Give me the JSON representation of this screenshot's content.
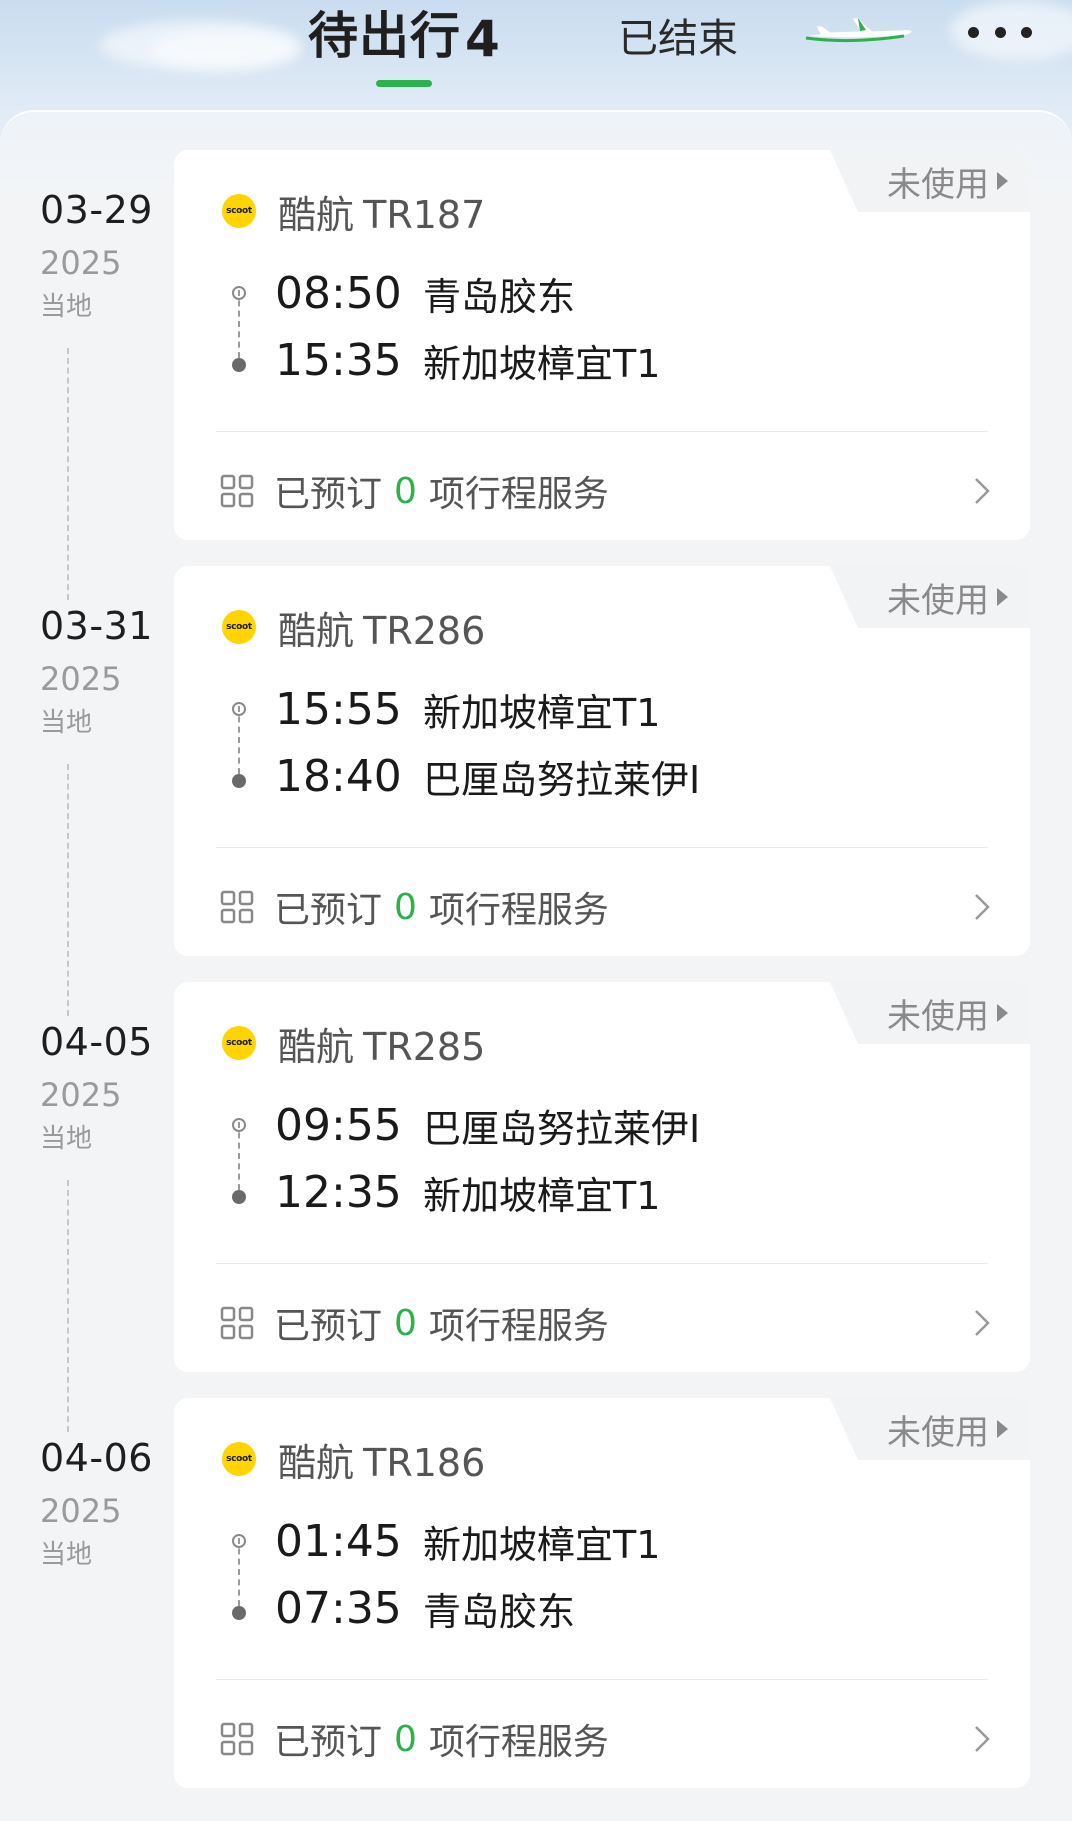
{
  "header": {
    "tab_active_label": "待出行",
    "tab_active_count": "4",
    "tab_inactive_label": "已结束"
  },
  "colors": {
    "accent_green": "#2bb24c",
    "scoot_yellow": "#ffd400"
  },
  "trips": [
    {
      "date_md": "03-29",
      "year": "2025",
      "tz": "当地",
      "status": "未使用",
      "airline": "酷航",
      "flight_no": "TR187",
      "airline_logo_text": "scoot",
      "dep_time": "08:50",
      "dep_airport": "青岛胶东",
      "arr_time": "15:35",
      "arr_airport": "新加坡樟宜T1",
      "services_prefix": "已预订",
      "services_count": "0",
      "services_suffix": "项行程服务"
    },
    {
      "date_md": "03-31",
      "year": "2025",
      "tz": "当地",
      "status": "未使用",
      "airline": "酷航",
      "flight_no": "TR286",
      "airline_logo_text": "scoot",
      "dep_time": "15:55",
      "dep_airport": "新加坡樟宜T1",
      "arr_time": "18:40",
      "arr_airport": "巴厘岛努拉莱伊I",
      "services_prefix": "已预订",
      "services_count": "0",
      "services_suffix": "项行程服务"
    },
    {
      "date_md": "04-05",
      "year": "2025",
      "tz": "当地",
      "status": "未使用",
      "airline": "酷航",
      "flight_no": "TR285",
      "airline_logo_text": "scoot",
      "dep_time": "09:55",
      "dep_airport": "巴厘岛努拉莱伊I",
      "arr_time": "12:35",
      "arr_airport": "新加坡樟宜T1",
      "services_prefix": "已预订",
      "services_count": "0",
      "services_suffix": "项行程服务"
    },
    {
      "date_md": "04-06",
      "year": "2025",
      "tz": "当地",
      "status": "未使用",
      "airline": "酷航",
      "flight_no": "TR186",
      "airline_logo_text": "scoot",
      "dep_time": "01:45",
      "dep_airport": "新加坡樟宜T1",
      "arr_time": "07:35",
      "arr_airport": "青岛胶东",
      "services_prefix": "已预订",
      "services_count": "0",
      "services_suffix": "项行程服务"
    }
  ]
}
